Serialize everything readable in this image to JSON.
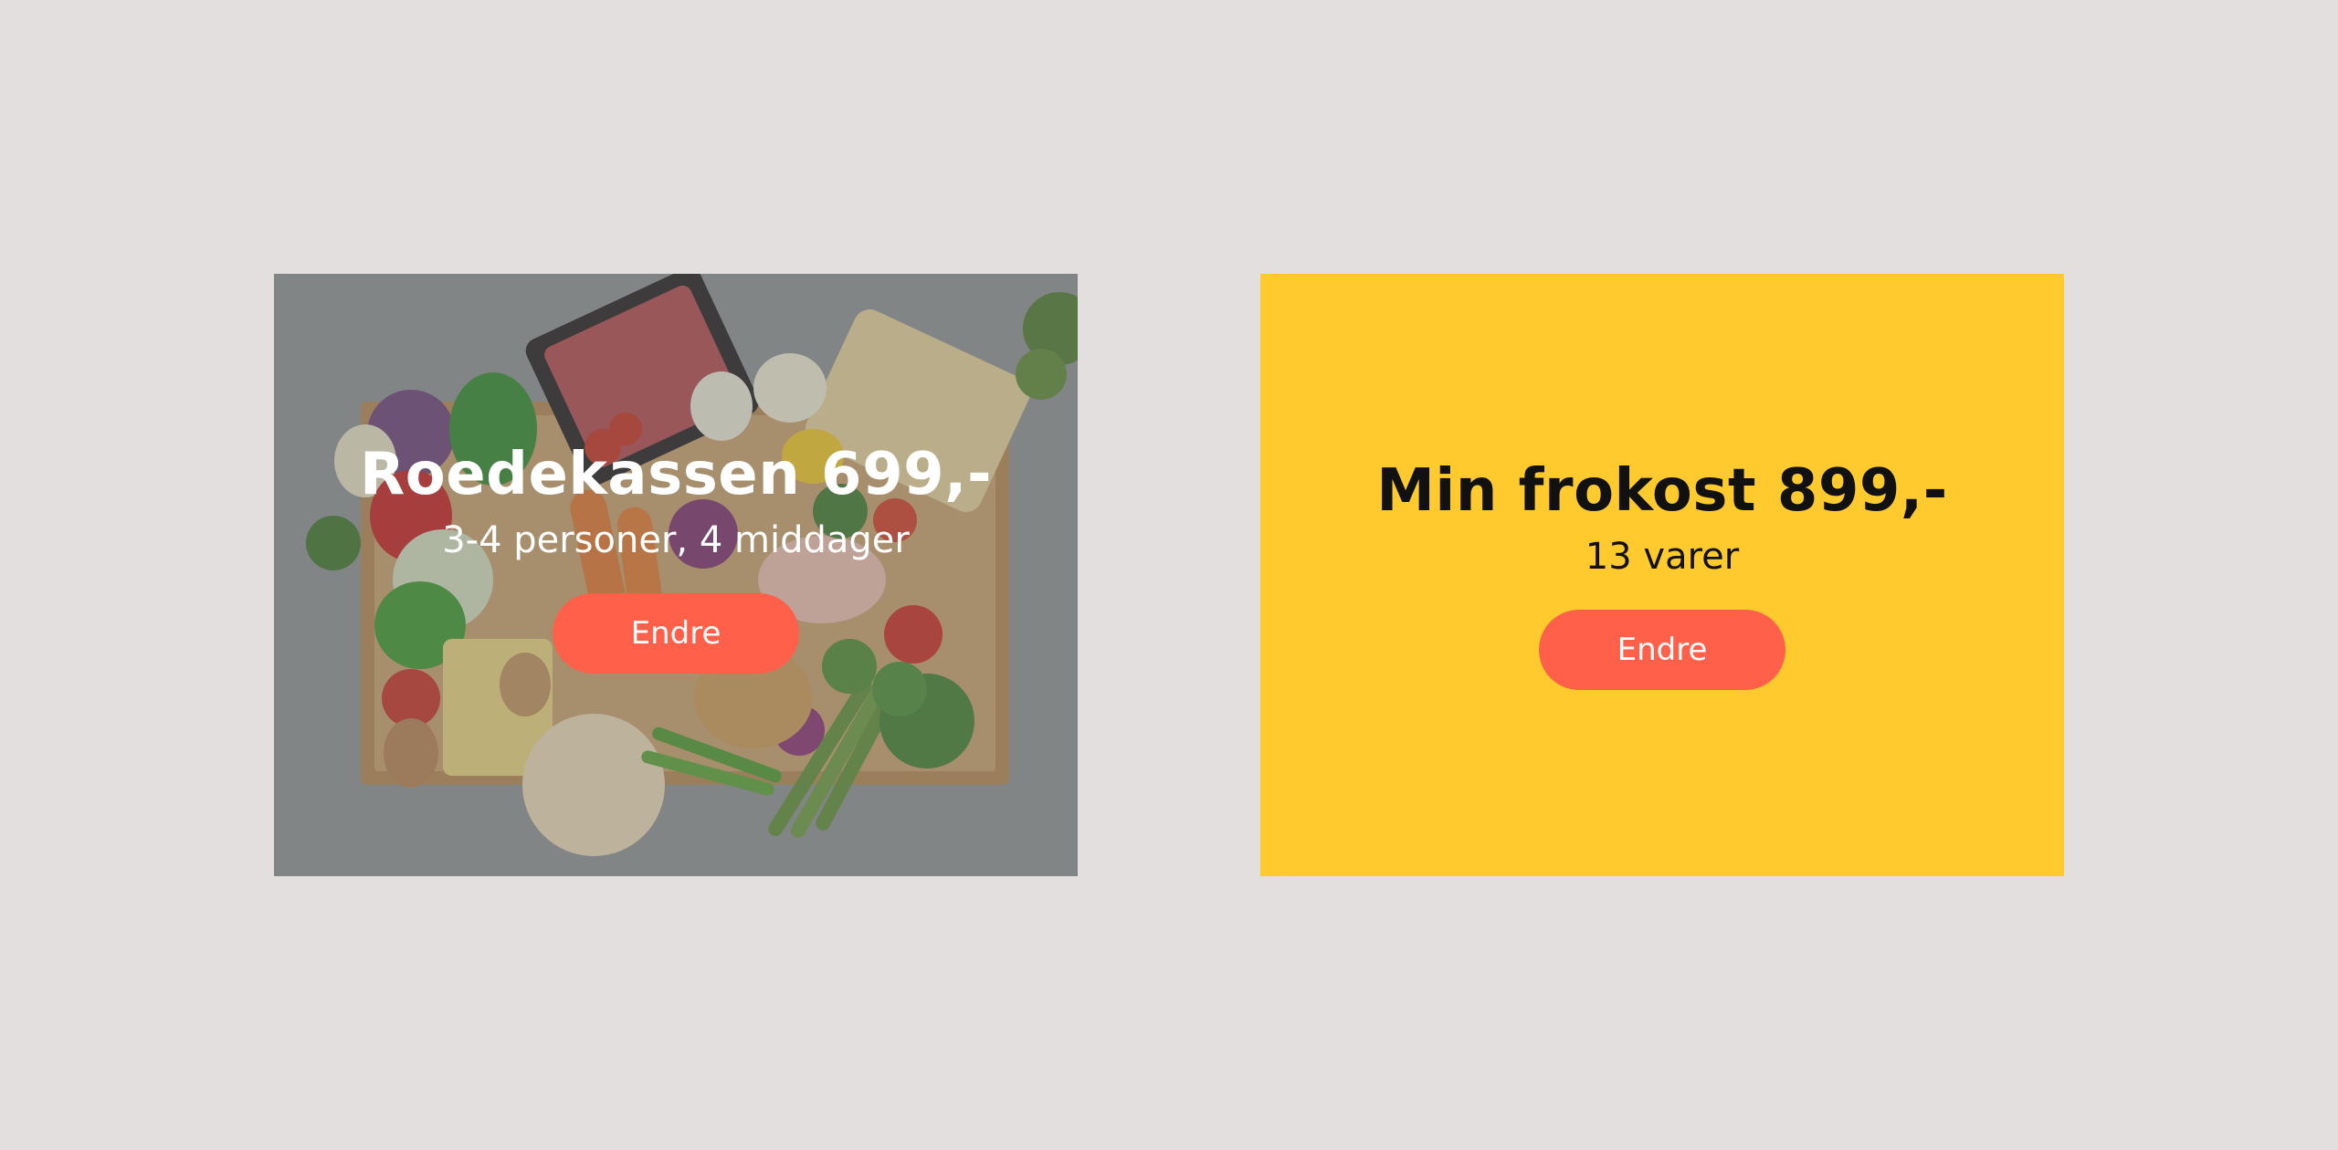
{
  "colors": {
    "page_background": "#e2dfde",
    "button": "#ff604a",
    "button_text": "#ffffff",
    "right_card_background": "#ffca2e",
    "left_card_text": "#ffffff",
    "right_card_text": "#111111"
  },
  "cards": [
    {
      "title": "Roedekassen 699,-",
      "subtitle": "3-4 personer, 4 middager",
      "button_label": "Endre",
      "background": "photo of vegetables, minced meat, noodles and bread in a cardboard box, darkened"
    },
    {
      "title": "Min frokost 899,-",
      "subtitle": "13 varer",
      "button_label": "Endre",
      "background": "#ffca2e"
    }
  ]
}
